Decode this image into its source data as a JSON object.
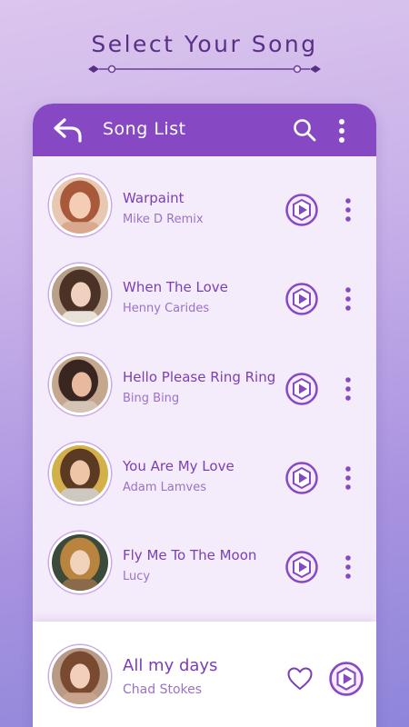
{
  "page": {
    "heading": "Select Your Song"
  },
  "toolbar": {
    "title": "Song List",
    "back_icon": "back-arrow-icon",
    "search_icon": "search-icon",
    "menu_icon": "more-vertical-icon"
  },
  "songs": [
    {
      "title": "Warpaint",
      "artist": "Mike D Remix"
    },
    {
      "title": "When The Love",
      "artist": "Henny Carides"
    },
    {
      "title": "Hello Please Ring Ring",
      "artist": "Bing Bing"
    },
    {
      "title": "You Are My Love",
      "artist": "Adam Lamves"
    },
    {
      "title": "Fly Me To The Moon",
      "artist": "Lucy"
    }
  ],
  "now_playing": {
    "title": "All my days",
    "artist": "Chad Stokes"
  },
  "colors": {
    "accent": "#8748c4",
    "list_background": "#f5ecfb",
    "title_text": "#7a3fb5",
    "subtitle_text": "#9a72c6",
    "heading_text": "#5a2f86"
  }
}
